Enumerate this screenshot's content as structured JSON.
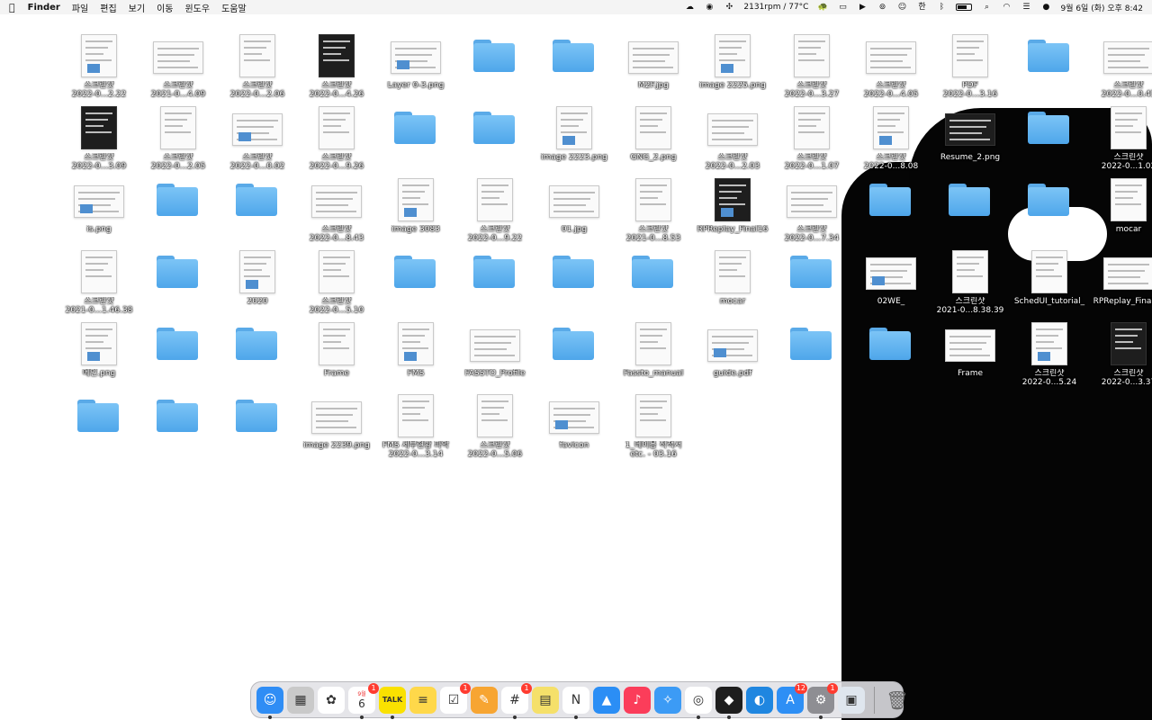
{
  "menubar": {
    "apple_icon": "apple-logo-icon",
    "app_name": "Finder",
    "menus": [
      "파일",
      "편집",
      "보기",
      "이동",
      "윈도우",
      "도움말"
    ],
    "fan_speed": "2131rpm / 77°C",
    "datetime": "9월 6일 (화) 오후 8:42",
    "status_icons": [
      "vpn-icon",
      "teamviewer-icon",
      "fan-icon",
      "turtle-icon",
      "display-icon",
      "play-icon",
      "airdrop-icon",
      "accessibility-icon",
      "keyboard-input-icon",
      "bluetooth-icon",
      "battery-icon",
      "search-icon",
      "wifi-icon",
      "control-center-icon",
      "siri-icon"
    ],
    "input_source": "한"
  },
  "desktop": {
    "items": [
      {
        "type": "file",
        "name": "스크린샷",
        "sub": "2022-0...2.22"
      },
      {
        "type": "file",
        "name": "스크린샷",
        "sub": "2021-0...4.09"
      },
      {
        "type": "file",
        "name": "스크린샷",
        "sub": "2022-0...2.06"
      },
      {
        "type": "file",
        "name": "스크린샷",
        "sub": "2022-0...4.26"
      },
      {
        "type": "file",
        "name": "Layer 0-3.png",
        "sub": ""
      },
      {
        "type": "folder",
        "name": "",
        "sub": ""
      },
      {
        "type": "folder",
        "name": "",
        "sub": ""
      },
      {
        "type": "file",
        "name": "M2F.jpg",
        "sub": ""
      },
      {
        "type": "file",
        "name": "image 2225.png",
        "sub": ""
      },
      {
        "type": "file",
        "name": "스크린샷",
        "sub": "2022-0...3.27"
      },
      {
        "type": "file",
        "name": "스크린샷",
        "sub": "2022-0...4.05"
      },
      {
        "type": "file",
        "name": "PDF",
        "sub": "2022-0...3.16"
      },
      {
        "type": "folder",
        "name": "",
        "sub": ""
      },
      {
        "type": "file",
        "name": "스크린샷",
        "sub": "2022-0...0.45"
      },
      {
        "type": "file",
        "name": "스크린샷",
        "sub": "2022-0...3.09"
      },
      {
        "type": "file",
        "name": "스크린샷",
        "sub": "2022-0...2.05"
      },
      {
        "type": "file",
        "name": "스크린샷",
        "sub": "2022-0...0.02"
      },
      {
        "type": "file",
        "name": "스크린샷",
        "sub": "2022-0...9.26"
      },
      {
        "type": "folder",
        "name": "",
        "sub": ""
      },
      {
        "type": "folder",
        "name": "",
        "sub": ""
      },
      {
        "type": "file",
        "name": "image 2223.png",
        "sub": ""
      },
      {
        "type": "file",
        "name": "GNG_2.png",
        "sub": ""
      },
      {
        "type": "file",
        "name": "스크린샷",
        "sub": "2022-0...2.03"
      },
      {
        "type": "file",
        "name": "스크린샷",
        "sub": "2022-0...1.07"
      },
      {
        "type": "file",
        "name": "스크린샷",
        "sub": "2022-0...8.08"
      },
      {
        "type": "file",
        "name": "Resume_2.png",
        "sub": ""
      },
      {
        "type": "folder",
        "name": "",
        "sub": ""
      },
      {
        "type": "file",
        "name": "스크린샷",
        "sub": "2022-0...1.02"
      },
      {
        "type": "file",
        "name": "is.png",
        "sub": ""
      },
      {
        "type": "folder",
        "name": "",
        "sub": ""
      },
      {
        "type": "folder",
        "name": "",
        "sub": ""
      },
      {
        "type": "file",
        "name": "스크린샷",
        "sub": "2022-0...8.43"
      },
      {
        "type": "file",
        "name": "image 3083",
        "sub": ""
      },
      {
        "type": "file",
        "name": "스크린샷",
        "sub": "2022-0...9.22"
      },
      {
        "type": "file",
        "name": "01.jpg",
        "sub": ""
      },
      {
        "type": "file",
        "name": "스크린샷",
        "sub": "2021-0...8.53"
      },
      {
        "type": "file",
        "name": "RPReplay_Final16",
        "sub": ""
      },
      {
        "type": "file",
        "name": "스크린샷",
        "sub": "2022-0...7.34"
      },
      {
        "type": "folder",
        "name": "",
        "sub": ""
      },
      {
        "type": "folder",
        "name": "",
        "sub": ""
      },
      {
        "type": "folder",
        "name": "",
        "sub": ""
      },
      {
        "type": "file",
        "name": "mocar",
        "sub": ""
      },
      {
        "type": "file",
        "name": "스크린샷",
        "sub": "2021-0...1.46.38"
      },
      {
        "type": "folder",
        "name": "",
        "sub": ""
      },
      {
        "type": "file",
        "name": "2020",
        "sub": ""
      },
      {
        "type": "file",
        "name": "스크린샷",
        "sub": "2022-0...5.10"
      },
      {
        "type": "folder",
        "name": "",
        "sub": ""
      },
      {
        "type": "folder",
        "name": "",
        "sub": ""
      },
      {
        "type": "folder",
        "name": "",
        "sub": ""
      },
      {
        "type": "folder",
        "name": "",
        "sub": ""
      },
      {
        "type": "file",
        "name": "mocar",
        "sub": ""
      },
      {
        "type": "folder",
        "name": "",
        "sub": ""
      },
      {
        "type": "file",
        "name": "02WE_",
        "sub": ""
      },
      {
        "type": "file",
        "name": "스크린샷",
        "sub": "2021-0...8.38.39"
      },
      {
        "type": "file",
        "name": "SchedUI_tutorial_",
        "sub": ""
      },
      {
        "type": "file",
        "name": "RPReplay_Final16",
        "sub": ""
      },
      {
        "type": "file",
        "name": "메인.png",
        "sub": ""
      },
      {
        "type": "folder",
        "name": "",
        "sub": ""
      },
      {
        "type": "folder",
        "name": "",
        "sub": ""
      },
      {
        "type": "file",
        "name": "Frame",
        "sub": ""
      },
      {
        "type": "file",
        "name": "FMS",
        "sub": ""
      },
      {
        "type": "file",
        "name": "FASSTO_Profile",
        "sub": ""
      },
      {
        "type": "folder",
        "name": "",
        "sub": ""
      },
      {
        "type": "file",
        "name": "Fassto_manual",
        "sub": ""
      },
      {
        "type": "file",
        "name": "guide.pdf",
        "sub": ""
      },
      {
        "type": "folder",
        "name": "",
        "sub": ""
      },
      {
        "type": "folder",
        "name": "",
        "sub": ""
      },
      {
        "type": "file",
        "name": "Frame",
        "sub": ""
      },
      {
        "type": "file",
        "name": "스크린샷",
        "sub": "2022-0...5.24"
      },
      {
        "type": "file",
        "name": "스크린샷",
        "sub": "2022-0...3.37"
      },
      {
        "type": "folder",
        "name": "",
        "sub": ""
      },
      {
        "type": "folder",
        "name": "",
        "sub": ""
      },
      {
        "type": "folder",
        "name": "",
        "sub": ""
      },
      {
        "type": "file",
        "name": "image 2239.png",
        "sub": ""
      },
      {
        "type": "file",
        "name": "FMS 세부현황 파악",
        "sub": "2022-0...3.14"
      },
      {
        "type": "file",
        "name": "스크린샷",
        "sub": "2022-0...5.06"
      },
      {
        "type": "file",
        "name": "favicon",
        "sub": ""
      },
      {
        "type": "file",
        "name": "1_데이용 직책서",
        "sub": "etc. - 03.16"
      }
    ]
  },
  "dock": {
    "apps": [
      {
        "name": "Finder",
        "icon": "finder-icon",
        "color": "#2f8df5",
        "badge": "",
        "running": true
      },
      {
        "name": "Launchpad",
        "icon": "launchpad-icon",
        "color": "#c9c9c9",
        "badge": "",
        "running": false
      },
      {
        "name": "Photos",
        "icon": "photos-icon",
        "color": "#ffffff",
        "badge": "",
        "running": false
      },
      {
        "name": "Calendar",
        "icon": "calendar-icon",
        "color": "#ffffff",
        "badge": "1",
        "running": true,
        "date": "6",
        "month": "9월"
      },
      {
        "name": "KakaoTalk",
        "icon": "kakaotalk-icon",
        "color": "#fae100",
        "badge": "",
        "running": true
      },
      {
        "name": "Notes",
        "icon": "notes-icon",
        "color": "#ffd84a",
        "badge": "",
        "running": false
      },
      {
        "name": "Reminders",
        "icon": "reminders-icon",
        "color": "#ffffff",
        "badge": "1",
        "running": false
      },
      {
        "name": "Pages",
        "icon": "pages-icon",
        "color": "#f7a532",
        "badge": "",
        "running": false
      },
      {
        "name": "Slack",
        "icon": "slack-icon",
        "color": "#ffffff",
        "badge": "1",
        "running": true
      },
      {
        "name": "Stickies",
        "icon": "stickies-icon",
        "color": "#f5e06a",
        "badge": "",
        "running": false
      },
      {
        "name": "Notion",
        "icon": "notion-icon",
        "color": "#ffffff",
        "badge": "",
        "running": true
      },
      {
        "name": "Keynote",
        "icon": "keynote-icon",
        "color": "#2b8ef5",
        "badge": "",
        "running": false
      },
      {
        "name": "Music",
        "icon": "music-icon",
        "color": "#fb3d5a",
        "badge": "",
        "running": false
      },
      {
        "name": "Safari",
        "icon": "safari-icon",
        "color": "#3c9bf5",
        "badge": "",
        "running": false
      },
      {
        "name": "Chrome",
        "icon": "chrome-icon",
        "color": "#ffffff",
        "badge": "",
        "running": true
      },
      {
        "name": "Figma",
        "icon": "figma-icon",
        "color": "#1e1e1e",
        "badge": "",
        "running": true
      },
      {
        "name": "Edge",
        "icon": "edge-icon",
        "color": "#1f86e0",
        "badge": "",
        "running": false
      },
      {
        "name": "App Store",
        "icon": "app-store-icon",
        "color": "#2e8ff5",
        "badge": "12",
        "running": false
      },
      {
        "name": "System Preferences",
        "icon": "system-preferences-icon",
        "color": "#8e8e93",
        "badge": "1",
        "running": true
      },
      {
        "name": "Preview",
        "icon": "preview-icon",
        "color": "#dfe6ee",
        "badge": "",
        "running": false
      }
    ],
    "trash": {
      "name": "Trash",
      "icon": "trash-icon"
    }
  },
  "colors": {
    "folder": "#5aaae8",
    "menubar": "#f4f4f4",
    "wallpaper_dark": "#050505"
  }
}
